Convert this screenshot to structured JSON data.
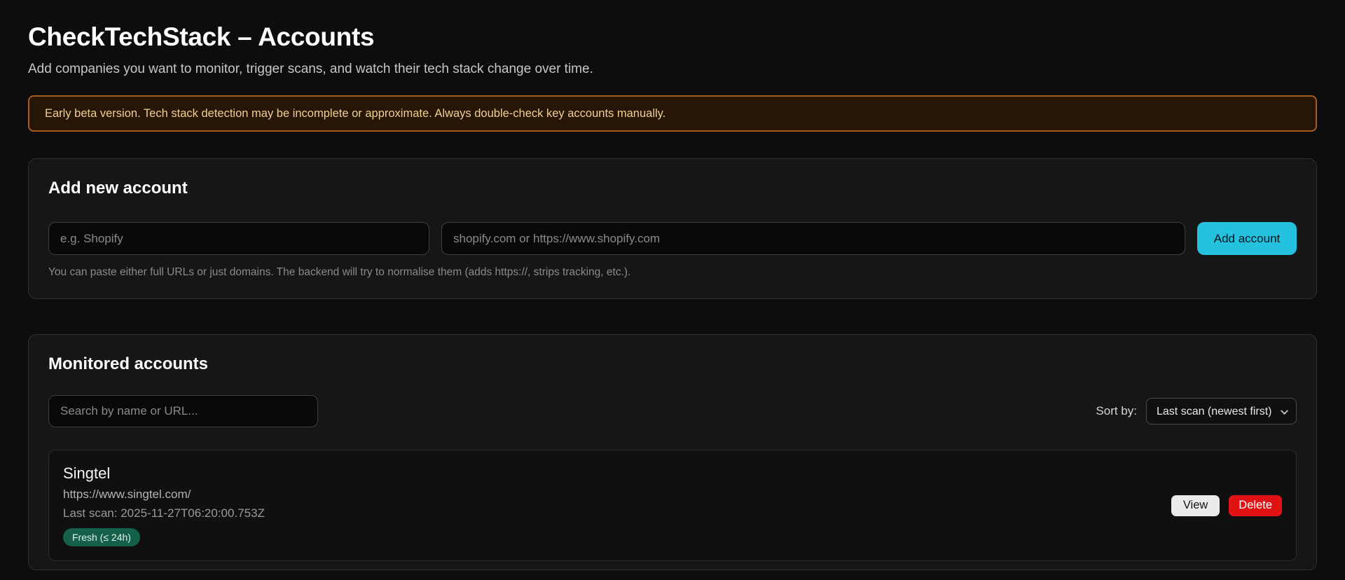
{
  "page": {
    "title": "CheckTechStack – Accounts",
    "subtitle": "Add companies you want to monitor, trigger scans, and watch their tech stack change over time."
  },
  "banner": {
    "text": "Early beta version. Tech stack detection may be incomplete or approximate. Always double-check key accounts manually."
  },
  "add_account": {
    "heading": "Add new account",
    "name_placeholder": "e.g. Shopify",
    "url_placeholder": "shopify.com or https://www.shopify.com",
    "button_label": "Add account",
    "helper": "You can paste either full URLs or just domains. The backend will try to normalise them (adds https://, strips tracking, etc.)."
  },
  "monitored": {
    "heading": "Monitored accounts",
    "search_placeholder": "Search by name or URL...",
    "sort_label": "Sort by:",
    "sort_selected": "Last scan (newest first)",
    "accounts": [
      {
        "name": "Singtel",
        "url": "https://www.singtel.com/",
        "last_scan": "Last scan: 2025-11-27T06:20:00.753Z",
        "badge": "Fresh (≤ 24h)",
        "view_label": "View",
        "delete_label": "Delete"
      }
    ]
  },
  "colors": {
    "accent_cyan": "#25c2e0",
    "danger_red": "#e21214",
    "badge_green_bg": "#15604a",
    "warning_bg": "#271505",
    "warning_border": "#a85c1d",
    "warning_text": "#efd093"
  }
}
